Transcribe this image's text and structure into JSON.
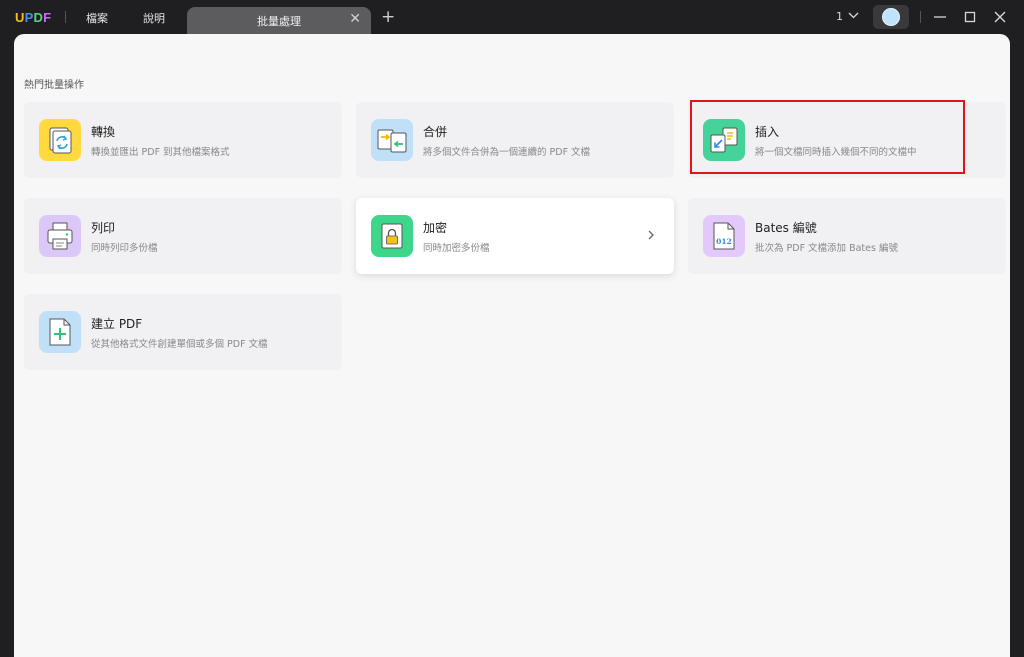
{
  "app": {
    "logo_letters": [
      "U",
      "P",
      "D",
      "F"
    ],
    "logo_colors": [
      "#f5c318",
      "#4a8bf5",
      "#5bd17a",
      "#c86cf2"
    ]
  },
  "menu": {
    "file": "檔案",
    "help": "說明"
  },
  "tab": {
    "label": "批量處理",
    "close": "✕",
    "add": "+"
  },
  "window": {
    "count": "1"
  },
  "section": {
    "title": "熱門批量操作"
  },
  "cards": [
    {
      "title": "轉換",
      "desc": "轉換並匯出 PDF 到其他檔案格式",
      "icon": "convert-icon",
      "color": "#ffd93d"
    },
    {
      "title": "合併",
      "desc": "將多個文件合併為一個連續的 PDF 文檔",
      "icon": "merge-icon",
      "color": "#bfe0f7"
    },
    {
      "title": "插入",
      "desc": "將一個文檔同時插入幾個不同的文檔中",
      "icon": "insert-icon",
      "color": "#46d39a"
    },
    {
      "title": "列印",
      "desc": "同時列印多份檔",
      "icon": "print-icon",
      "color": "#dcc8f8"
    },
    {
      "title": "加密",
      "desc": "同時加密多份檔",
      "icon": "lock-icon",
      "color": "#3ed68a"
    },
    {
      "title": "Bates 編號",
      "desc": "批次為 PDF 文檔添加 Bates 編號",
      "icon": "bates-number-icon",
      "color": "#e3c9fb",
      "icon_text": "012"
    },
    {
      "title": "建立 PDF",
      "desc": "從其他格式文件創建單個或多個 PDF 文檔",
      "icon": "create-pdf-icon",
      "color": "#bfe0f7"
    }
  ]
}
